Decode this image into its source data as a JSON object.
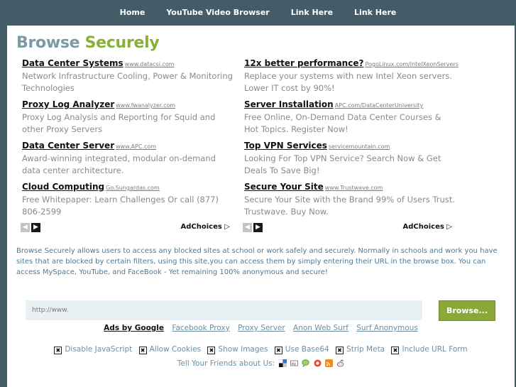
{
  "nav": {
    "items": [
      "Home",
      "YouTube Video Browser",
      "Link Here",
      "Link Here"
    ]
  },
  "title": {
    "word1": "Browse",
    "word2": "Securely"
  },
  "ads": {
    "left": [
      {
        "title": "Data Center Systems",
        "url": "www.datacsi.com",
        "desc": "Network Infrastructure Cooling, Power & Monitoring Technologies"
      },
      {
        "title": "Proxy Log Analyzer",
        "url": "www.fwanalyzer.com",
        "desc": "Proxy Log Analysis and Reporting for Squid and other Proxy Servers"
      },
      {
        "title": "Data Center Server",
        "url": "www.APC.com",
        "desc": "Award-winning integrated, modular on-demand data center architecture."
      },
      {
        "title": "Cloud Computing",
        "url": "Go.Sungardas.com",
        "desc": "Free Whitepaper: Learn Challenges Or call (877) 806-2599"
      }
    ],
    "right": [
      {
        "title": "12x better performance?",
        "url": "PogoLinux.com/IntelXeonServers",
        "desc": "Replace your systems with new Intel Xeon servers. Lower IT cost by 90%!"
      },
      {
        "title": "Server Installation",
        "url": "APC.com/DataCenterUniversity",
        "desc": "Free Online, On-Demand Data Center Courses & Hot Topics. Register Now!"
      },
      {
        "title": "Top VPN Services",
        "url": "servicemountain.com",
        "desc": "Looking For Top VPN Service? Search Now & Get Deals To Save Big!"
      },
      {
        "title": "Secure Your Site",
        "url": "www.Trustwave.com",
        "desc": "Secure Your Site with the Brand 99% of Users Trust. Trustwave. Buy Now."
      }
    ],
    "adchoices_label": "AdChoices",
    "adchoices_glyph": "▷",
    "prev_glyph": "◀",
    "next_glyph": "▶"
  },
  "description": "Browse Securely allows users to access any blocked sites at school or work safely and securely. Normally in schools and work you have sites that are blocked by certain filters, using this site,you can access them by simply entering their URL in the browse box. You can access MySpace, YouTube, and FaceBook - Yet remaining 100% anonymous and secure!",
  "search": {
    "value": "http://www.",
    "button": "Browse..."
  },
  "links": {
    "ads_by": "Ads by Google",
    "items": [
      "Facebook Proxy",
      "Proxy Server",
      "Anon Web Surf",
      "Surf Anonymous"
    ]
  },
  "options": [
    {
      "label": "Disable JavaScript",
      "checked": true
    },
    {
      "label": "Allow Cookies",
      "checked": true
    },
    {
      "label": "Show Images",
      "checked": true
    },
    {
      "label": "Use Base64",
      "checked": true
    },
    {
      "label": "Strip Meta",
      "checked": true
    },
    {
      "label": "Include URL Form",
      "checked": true
    }
  ],
  "checkbox_glyph": "✖",
  "share": {
    "label": "Tell Your Friends about Us:",
    "icons": [
      "delicious-icon",
      "digg-icon",
      "speech-bubble-icon",
      "stumbleupon-icon",
      "feed-icon",
      "reddit-icon"
    ]
  },
  "colors": {
    "background": "#445c68",
    "title_word1": "#7a9aa8",
    "title_word2": "#8aaf36",
    "link": "#6a8fa5",
    "button": "#8aa838"
  }
}
